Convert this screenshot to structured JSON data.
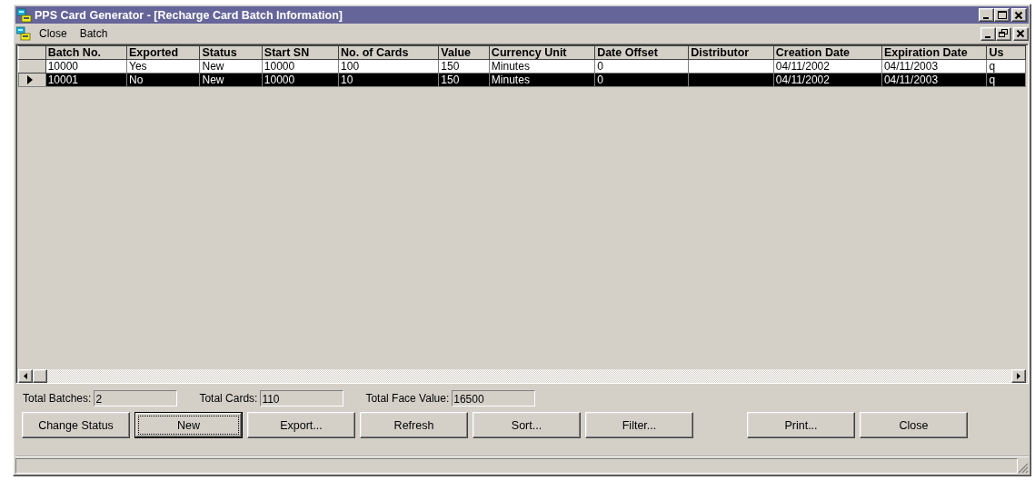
{
  "window": {
    "title": "PPS Card Generator - [Recharge Card Batch Information]"
  },
  "menu": [
    {
      "label": "Close"
    },
    {
      "label": "Batch"
    }
  ],
  "table": {
    "columns": [
      "Batch No.",
      "Exported",
      "Status",
      "Start SN",
      "No. of Cards",
      "Value",
      "Currency Unit",
      "Date Offset",
      "Distributor",
      "Creation Date",
      "Expiration Date",
      "Us"
    ],
    "rows": [
      {
        "selected": false,
        "cells": [
          "10000",
          "Yes",
          "New",
          "10000",
          "100",
          "150",
          "Minutes",
          "0",
          "",
          "04/11/2002",
          "04/11/2003",
          "q"
        ]
      },
      {
        "selected": true,
        "cells": [
          "10001",
          "No",
          "New",
          "10000",
          "10",
          "150",
          "Minutes",
          "0",
          "",
          "04/11/2002",
          "04/11/2003",
          "q"
        ]
      }
    ]
  },
  "totals": [
    {
      "label": "Total Batches:",
      "value": "2"
    },
    {
      "label": "Total Cards:",
      "value": "110"
    },
    {
      "label": "Total Face Value:",
      "value": "16500"
    }
  ],
  "buttons": [
    {
      "label": "Change Status",
      "focused": false
    },
    {
      "label": "New",
      "focused": true
    },
    {
      "label": "Export...",
      "focused": false
    },
    {
      "label": "Refresh",
      "focused": false
    },
    {
      "label": "Sort...",
      "focused": false
    },
    {
      "label": "Filter...",
      "focused": false
    },
    {
      "label": "Print...",
      "focused": false
    },
    {
      "label": "Close",
      "focused": false
    }
  ]
}
